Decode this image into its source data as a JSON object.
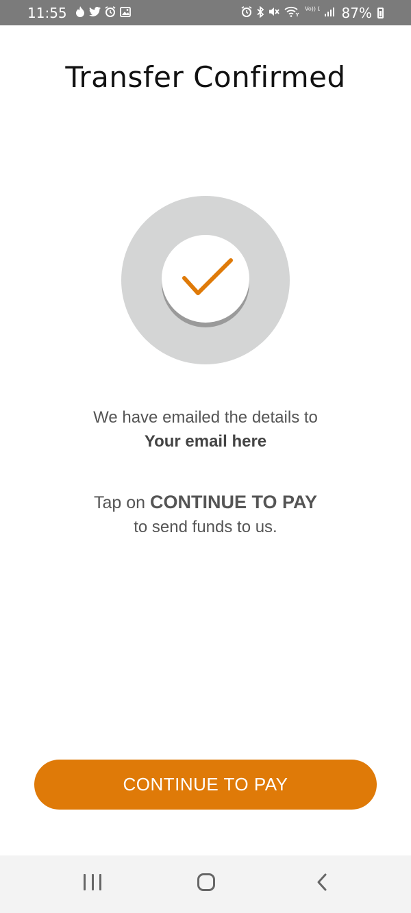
{
  "status_bar": {
    "time": "11:55",
    "battery": "87%",
    "left_icons": [
      "fire-icon",
      "twitter-icon",
      "alarm-icon",
      "image-icon"
    ],
    "right_icons": [
      "alarm-icon",
      "bluetooth-icon",
      "mute-icon",
      "wifi-icon",
      "volte-icon",
      "signal-icon",
      "battery-icon"
    ],
    "volte_label": "Vo)) LTE1"
  },
  "page": {
    "title": "Transfer Confirmed"
  },
  "confirmation": {
    "icon": "checkmark-icon",
    "check_color": "#df7a08"
  },
  "message": {
    "line1": "We have emailed the details to",
    "email": "Your email here",
    "tap_prefix": "Tap on ",
    "tap_bold": "CONTINUE TO PAY",
    "tap_suffix": "to send funds to us."
  },
  "actions": {
    "continue_label": "CONTINUE TO PAY",
    "button_color": "#df7a08"
  },
  "nav_bar": {
    "icons": [
      "recent-apps-icon",
      "home-icon",
      "back-icon"
    ]
  }
}
